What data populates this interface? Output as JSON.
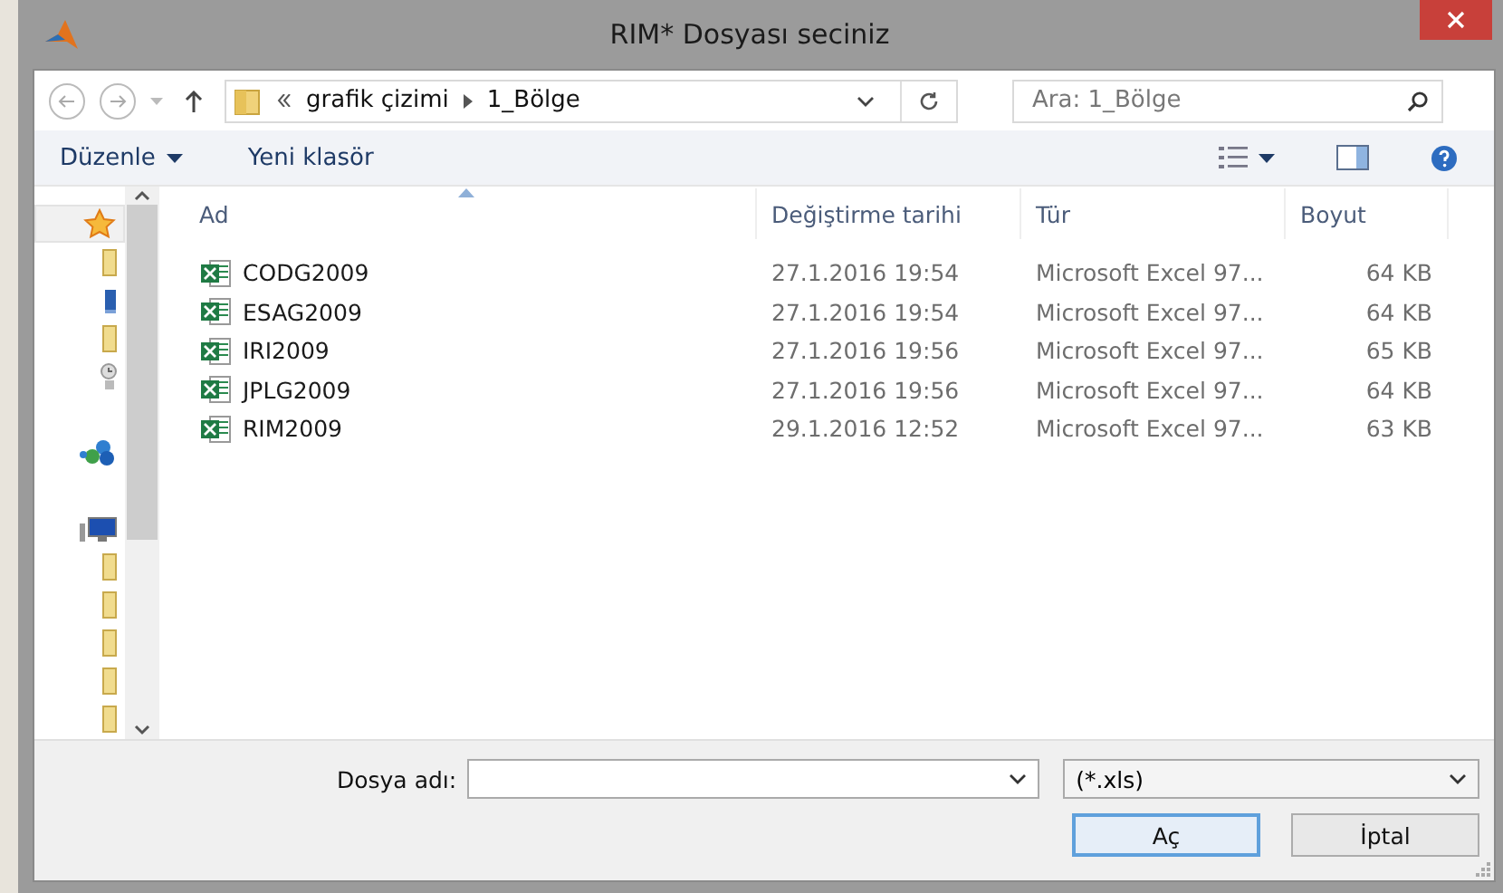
{
  "window": {
    "title": "RIM* Dosyası seciniz"
  },
  "address": {
    "path": [
      {
        "label": "grafik çizimi"
      },
      {
        "label": "1_Bölge"
      }
    ]
  },
  "search": {
    "placeholder": "Ara: 1_Bölge"
  },
  "toolbar": {
    "items": [
      {
        "label": "Düzenle",
        "kind": "menu"
      },
      {
        "label": "Yeni klasör",
        "kind": "action"
      }
    ]
  },
  "sidebar": {
    "items": [
      {
        "kind": "favorites",
        "selected": true
      },
      {
        "kind": "folder",
        "selected": false
      },
      {
        "kind": "desktop",
        "selected": false
      },
      {
        "kind": "folder",
        "selected": false
      },
      {
        "kind": "recent",
        "selected": false
      },
      {
        "kind": "network",
        "selected": false
      },
      {
        "kind": "computer",
        "selected": false
      },
      {
        "kind": "folder",
        "selected": false
      },
      {
        "kind": "folder",
        "selected": false
      },
      {
        "kind": "folder",
        "selected": false
      },
      {
        "kind": "folder",
        "selected": false
      },
      {
        "kind": "folder",
        "selected": false
      }
    ]
  },
  "table": {
    "columns": [
      {
        "label": "Ad",
        "sorted": true
      },
      {
        "label": "Değiştirme tarihi",
        "sorted": false
      },
      {
        "label": "Tür",
        "sorted": false
      },
      {
        "label": "Boyut",
        "sorted": false
      }
    ],
    "rows": [
      {
        "name": "CODG2009",
        "modified": "27.1.2016 19:54",
        "type": "Microsoft Excel 97...",
        "size": "64 KB"
      },
      {
        "name": "ESAG2009",
        "modified": "27.1.2016 19:54",
        "type": "Microsoft Excel 97...",
        "size": "64 KB"
      },
      {
        "name": "IRI2009",
        "modified": "27.1.2016 19:56",
        "type": "Microsoft Excel 97...",
        "size": "65 KB"
      },
      {
        "name": "JPLG2009",
        "modified": "27.1.2016 19:56",
        "type": "Microsoft Excel 97...",
        "size": "64 KB"
      },
      {
        "name": "RIM2009",
        "modified": "29.1.2016 12:52",
        "type": "Microsoft Excel 97...",
        "size": "63 KB"
      }
    ]
  },
  "file_name": {
    "label": "Dosya adı:"
  },
  "file_type": {
    "value": "(*.xls)"
  },
  "buttons": [
    {
      "label": "Aç",
      "default": true
    },
    {
      "label": "İptal",
      "default": false
    }
  ]
}
